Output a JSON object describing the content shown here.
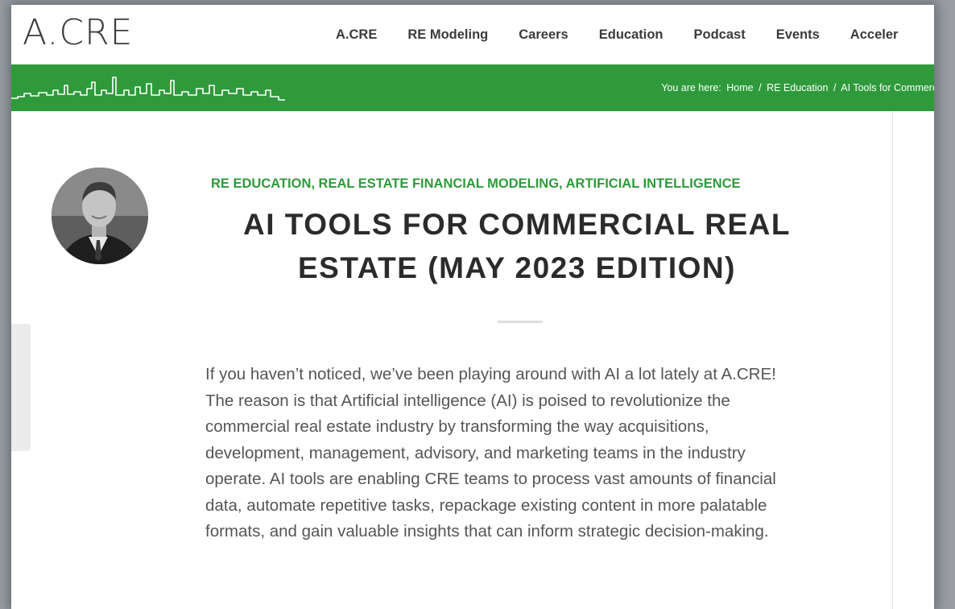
{
  "header": {
    "logo_text": "A.CRE",
    "nav": [
      "A.CRE",
      "RE Modeling",
      "Careers",
      "Education",
      "Podcast",
      "Events",
      "Acceler"
    ]
  },
  "breadcrumb": {
    "prefix": "You are here:",
    "items": [
      "Home",
      "RE Education",
      "AI Tools for Commerci"
    ],
    "separator": "/"
  },
  "post": {
    "categories": "RE EDUCATION, REAL ESTATE FINANCIAL MODELING, ARTIFICIAL INTELLIGENCE",
    "title": "AI TOOLS FOR COMMERCIAL REAL ESTATE (MAY 2023 EDITION)",
    "intro": "If you haven’t noticed, we’ve been playing around with AI a lot lately at A.CRE! The reason is that Artificial intelligence (AI) is poised to revolutionize the commercial real estate industry by transforming the way acquisitions, development, management, advisory, and marketing teams in the industry operate. AI tools are enabling CRE teams to process vast amounts of financial data, automate repetitive tasks, repackage existing content in more palatable formats, and gain valuable insights that can inform strategic decision-making."
  },
  "colors": {
    "brand_green": "#2f9a3b",
    "text_dark": "#2b2b2b",
    "text_body": "#555555"
  },
  "icons": {
    "skyline": "city-skyline-illustration",
    "author": "author-avatar"
  }
}
